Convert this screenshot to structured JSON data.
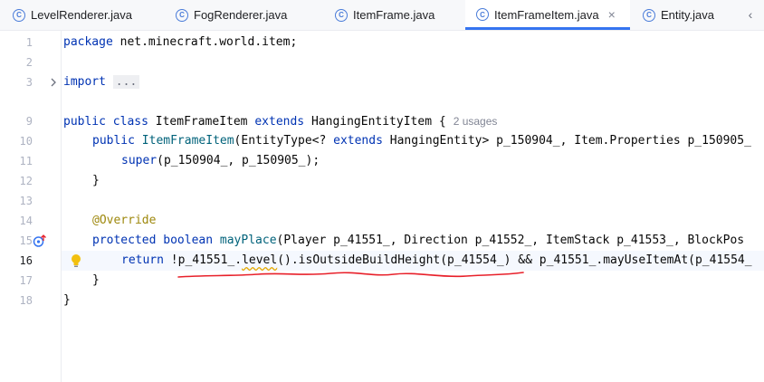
{
  "tabs": [
    {
      "label": "LevelRenderer.java",
      "active": false
    },
    {
      "label": "FogRenderer.java",
      "active": false
    },
    {
      "label": "ItemFrame.java",
      "active": false
    },
    {
      "label": "ItemFrameItem.java",
      "active": true
    },
    {
      "label": "Entity.java",
      "active": false
    }
  ],
  "tab_icon": "class-c-icon",
  "tab_close_glyph": "×",
  "scroll_more_glyph": "‹",
  "line_numbers": [
    "1",
    "2",
    "3",
    "9",
    "10",
    "11",
    "12",
    "13",
    "14",
    "15",
    "16",
    "17",
    "18"
  ],
  "current_line": "16",
  "code": {
    "l1_kw": "package",
    "l1_rest": " net.minecraft.world.item;",
    "l3_kw": "import",
    "l3_fold": "...",
    "l9_kw1": "public",
    "l9_kw2": "class",
    "l9_name": " ItemFrameItem ",
    "l9_kw3": "extends",
    "l9_rest": " HangingEntityItem {",
    "l9_usages": "2 usages",
    "l10_kw": "public",
    "l10_fn": "ItemFrameItem",
    "l10_a": "(EntityType<? ",
    "l10_kw2": "extends",
    "l10_b": " HangingEntity> p_150904_, Item.Properties p_150905_",
    "l11_kw": "super",
    "l11_rest": "(p_150904_, p_150905_);",
    "l12": "}",
    "l14_ann": "@Override",
    "l15_kw1": "protected",
    "l15_kw2": "boolean",
    "l15_fn": "mayPlace",
    "l15_rest": "(Player p_41551_, Direction p_41552_, ItemStack p_41553_, BlockPos",
    "l16_kw": "return",
    "l16_a": " !p_41551_.",
    "l16_wavy": "level",
    "l16_b": "().isOutsideBuildHeight(p_41554_) && p_41551_.mayUseItemAt(p_41554_",
    "l17": "}",
    "l18": "}"
  },
  "colors": {
    "keyword": "#0033b3",
    "function": "#00627a",
    "annotation": "#9e880d",
    "error_squiggle": "#e8202a",
    "tab_underline": "#3574f0"
  },
  "gutter_icons": [
    "fold-chevron-icon",
    "override-method-icon",
    "lightbulb-icon"
  ]
}
